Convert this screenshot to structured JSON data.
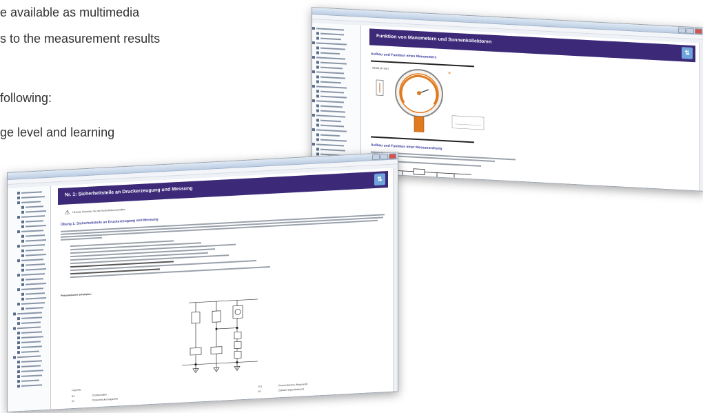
{
  "background_text": {
    "line1": "e available as multimedia",
    "line2": "s to the measurement results",
    "line3": "following:",
    "line4": "ge level and learning"
  },
  "back_window": {
    "header_title": "Funktion von Manometern und Sonnenkollektoren",
    "section1": "Aufbau und Funktion eines Manometers",
    "section2": "Aufbau und Funktion einer Messanordnung",
    "gauge_label": "Skala (in bar)",
    "header_icon": "grid-arrows-icon"
  },
  "front_window": {
    "header_title": "Nr. 1: Sicherheitsteile an Druckerzeugung und Messung",
    "warning": "Hinweis: Beachten Sie die Sicherheitsvorschriften",
    "section_title": "Übung 1: Sicherheitsteile an Druckerzeugung und Messung",
    "diagram_label": "Pneumatischer Schaltplan:",
    "legend_title": "Legende",
    "legend_rows": [
      {
        "code": "B1",
        "text": "Druckschalter",
        "code2": "1V1",
        "text2": "Pneumatisches Wegeventil"
      },
      {
        "code": "Z1",
        "text": "Drosselrückschlagventil",
        "code2": "1A",
        "text2": "Zylinder doppeltwirkend"
      }
    ],
    "header_icon": "grid-arrows-icon"
  },
  "colors": {
    "header_bg": "#3c2a79",
    "header_icon": "#6fa3dc",
    "subtitle": "#3a3e9c",
    "gauge": "#e07a1f"
  }
}
